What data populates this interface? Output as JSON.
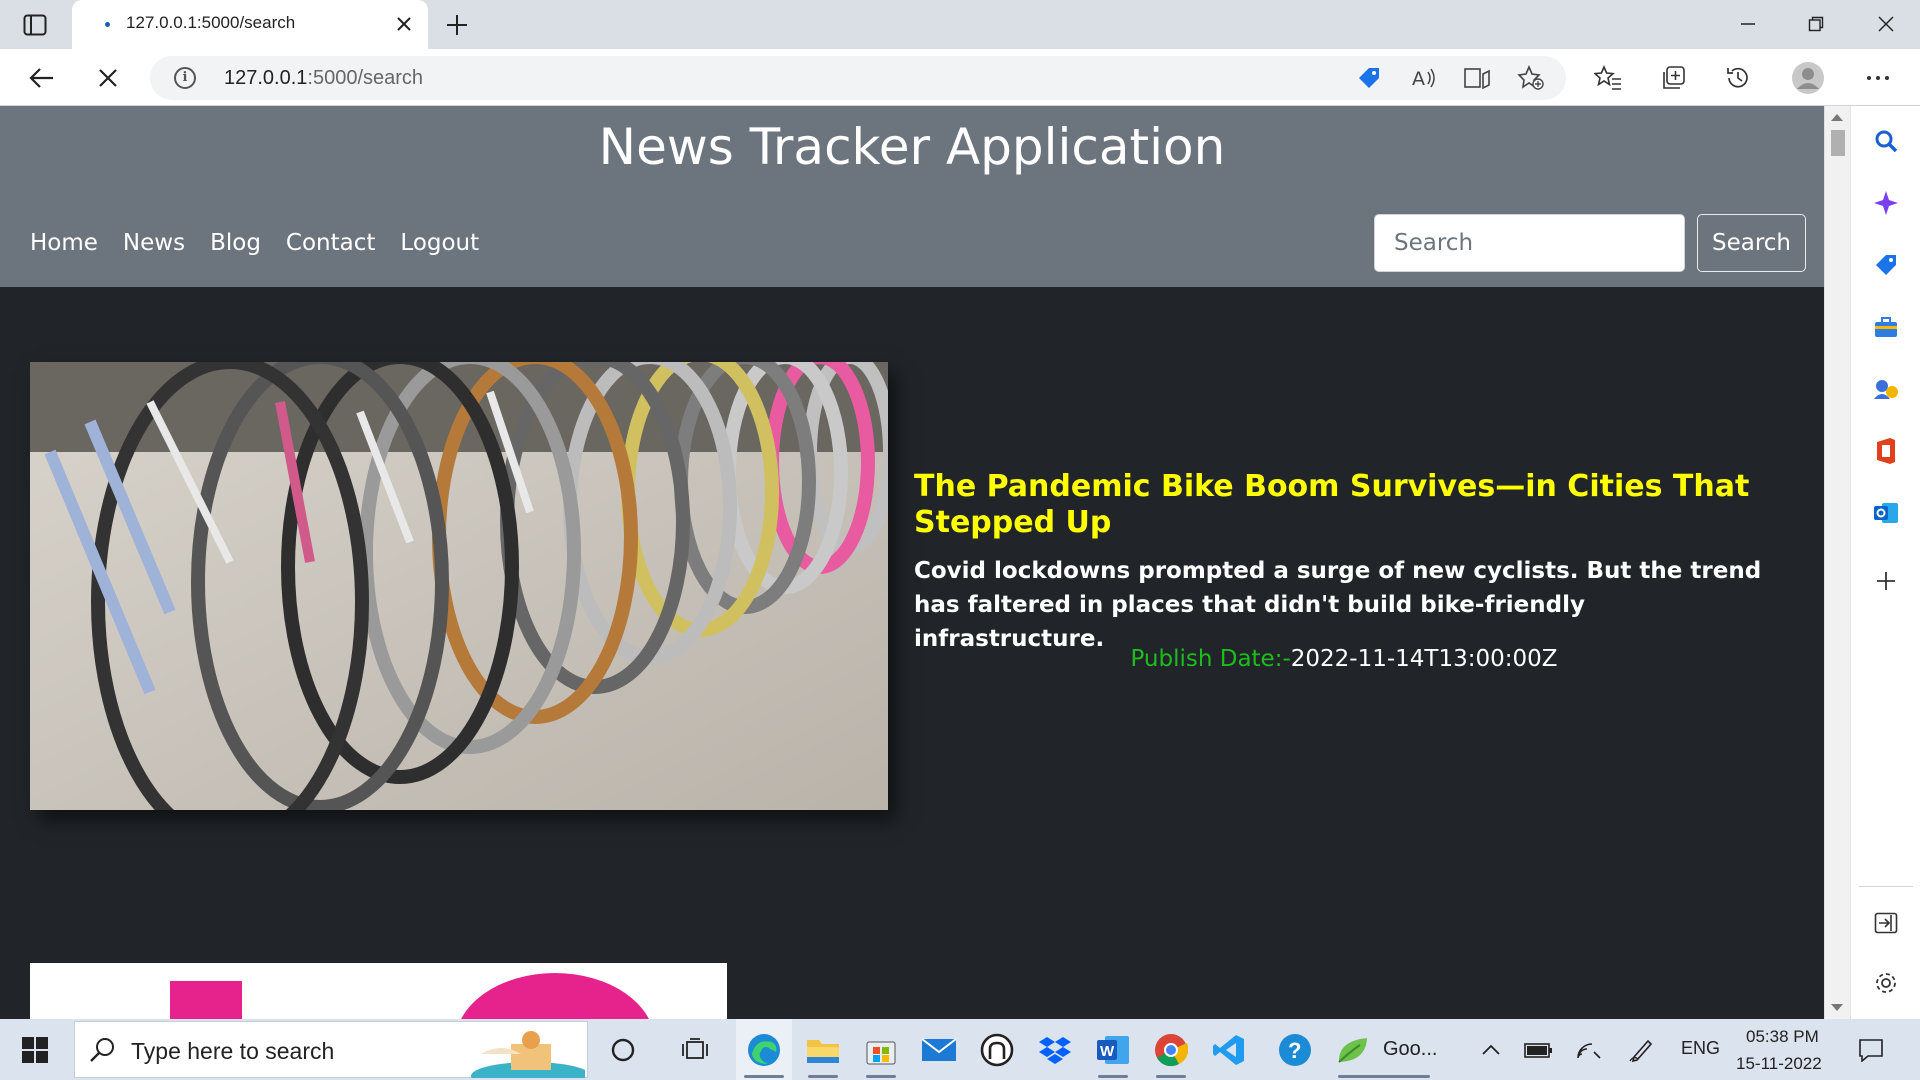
{
  "browser": {
    "tab_title": "127.0.0.1:5000/search",
    "url_host": "127.0.0.1",
    "url_path": ":5000/search"
  },
  "site": {
    "title": "News Tracker Application",
    "nav": [
      "Home",
      "News",
      "Blog",
      "Contact",
      "Logout"
    ],
    "search_placeholder": "Search",
    "search_button": "Search"
  },
  "article": {
    "title": "The Pandemic Bike Boom Survives—in Cities That Stepped Up",
    "description": "Covid lockdowns prompted a surge of new cyclists. But the trend has faltered in places that didn't build bike-friendly infrastructure.",
    "date_label": "Publish Date:-",
    "date_value": "2022-11-14T13:00:00Z",
    "image": "bicycles-in-a-row"
  },
  "taskbar": {
    "search_placeholder": "Type here to search",
    "app_label": "Goo...",
    "language": "ENG",
    "time": "05:38 PM",
    "date": "15-11-2022"
  },
  "colors": {
    "header_bg": "#6c757d",
    "page_bg": "#212529",
    "title_color": "#ffff00",
    "date_label_color": "#1cbd1c"
  }
}
